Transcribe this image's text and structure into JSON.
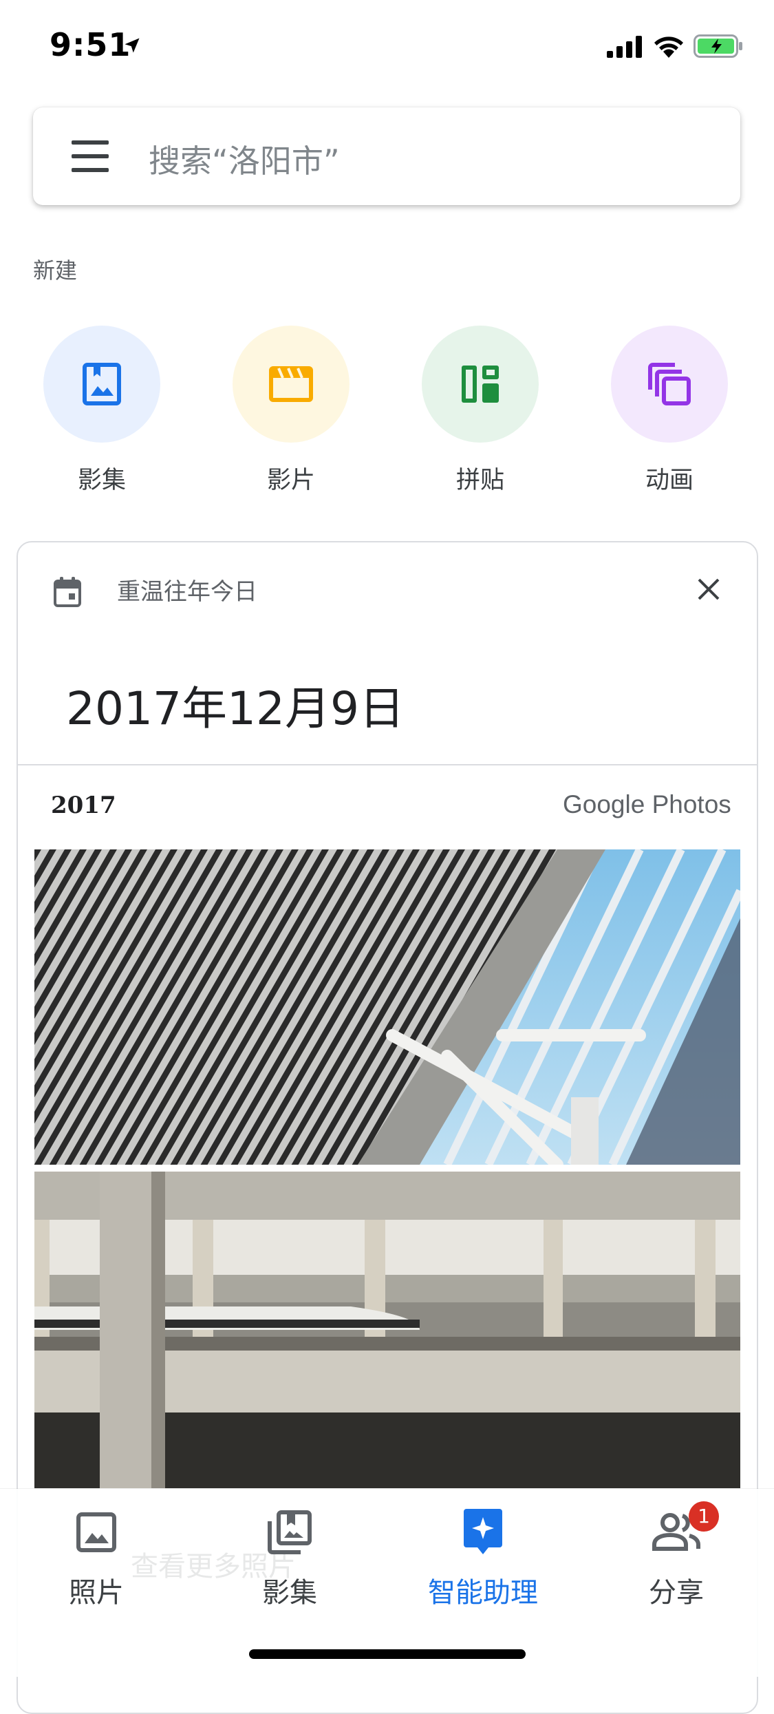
{
  "status_bar": {
    "time": "9:51"
  },
  "search": {
    "placeholder": "搜索“洛阳市”"
  },
  "new_section": {
    "heading": "新建",
    "items": [
      {
        "label": "影集",
        "icon": "album-icon",
        "bg": "#e8f0fe",
        "color": "#1a73e8"
      },
      {
        "label": "影片",
        "icon": "movie-icon",
        "bg": "#fef7e0",
        "color": "#f9ab00"
      },
      {
        "label": "拼贴",
        "icon": "collage-icon",
        "bg": "#e6f4ea",
        "color": "#1e8e3e"
      },
      {
        "label": "动画",
        "icon": "animation-icon",
        "bg": "#f3e8fd",
        "color": "#9334e6"
      }
    ]
  },
  "memory": {
    "label": "重温往年今日",
    "date": "2017年12月9日",
    "year": "2017",
    "brand": "Google Photos"
  },
  "bottom_nav": {
    "ghost_text": "查看更多照片",
    "items": [
      {
        "label": "照片",
        "icon": "photo-icon",
        "active": false
      },
      {
        "label": "影集",
        "icon": "albums-icon",
        "active": false
      },
      {
        "label": "智能助理",
        "icon": "assistant-icon",
        "active": true
      },
      {
        "label": "分享",
        "icon": "sharing-icon",
        "active": false,
        "badge": "1"
      }
    ]
  },
  "colors": {
    "accent": "#1a73e8",
    "badge": "#d93025"
  }
}
